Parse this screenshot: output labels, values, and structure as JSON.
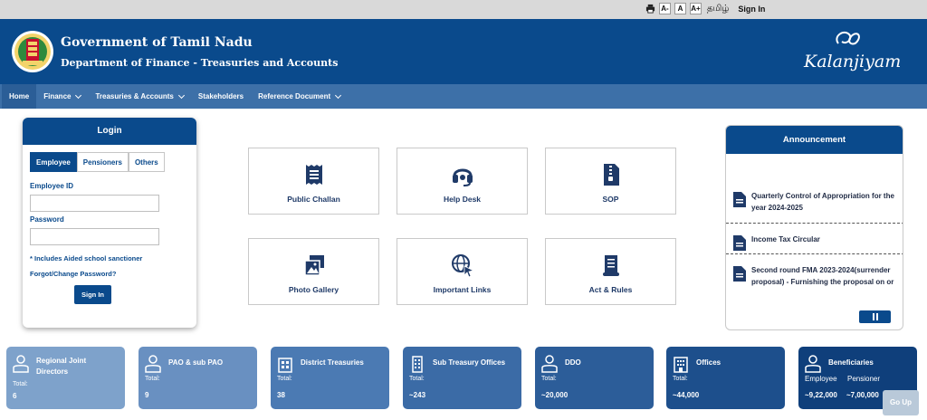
{
  "topbar": {
    "font_small": "A-",
    "font_normal": "A",
    "font_large": "A+",
    "language": "தமிழ்",
    "signin": "Sign In"
  },
  "header": {
    "title": "Government of Tamil Nadu",
    "subtitle": "Department of Finance - Treasuries and Accounts",
    "brand": "Kalanjiyam"
  },
  "nav": {
    "items": [
      {
        "label": "Home"
      },
      {
        "label": "Finance"
      },
      {
        "label": "Treasuries & Accounts"
      },
      {
        "label": "Stakeholders"
      },
      {
        "label": "Reference Document"
      }
    ]
  },
  "login": {
    "heading": "Login",
    "tabs": [
      "Employee",
      "Pensioners",
      "Others"
    ],
    "employee_id_label": "Employee ID",
    "employee_id_value": "",
    "password_label": "Password",
    "password_value": "",
    "note": "* Includes Aided school sanctioner",
    "forgot": "Forgot/Change Password?",
    "submit": "Sign In"
  },
  "services": [
    {
      "label": "Public Challan",
      "icon": "receipt-icon"
    },
    {
      "label": "Help Desk",
      "icon": "headset-icon"
    },
    {
      "label": "SOP",
      "icon": "zip-file-icon"
    },
    {
      "label": "Photo Gallery",
      "icon": "photo-gallery-icon"
    },
    {
      "label": "Important Links",
      "icon": "globe-cursor-icon"
    },
    {
      "label": "Act & Rules",
      "icon": "scroll-icon"
    }
  ],
  "announcement": {
    "heading": "Announcement",
    "items": [
      "Quarterly Control of Appropriation for the year 2024-2025",
      "Income Tax Circular",
      "Second round FMA 2023-2024(surrender proposal) - Furnishing the proposal on or"
    ]
  },
  "stats": [
    {
      "title": "Regional Joint Directors",
      "total_label": "Total:",
      "value": "6",
      "color": "#7ea2cb"
    },
    {
      "title": "PAO & sub PAO",
      "total_label": "Total:",
      "value": "9",
      "color": "#6990c1"
    },
    {
      "title": "District Treasuries",
      "total_label": "Total:",
      "value": "38",
      "color": "#4b7ab3"
    },
    {
      "title": "Sub Treasury Offices",
      "total_label": "Total:",
      "value": "~243",
      "color": "#3b6ba6"
    },
    {
      "title": "DDO",
      "total_label": "Total:",
      "value": "~20,000",
      "color": "#2c5d99"
    },
    {
      "title": "Offices",
      "total_label": "Total:",
      "value": "~44,000",
      "color": "#1d4f8c"
    },
    {
      "title": "Beneficiaries",
      "sub1": "Employee",
      "sub2": "Pensioner",
      "val1": "~9,22,000",
      "val2": "~7,00,000",
      "color": "#0f3f7b"
    }
  ],
  "go_up": "Go Up",
  "colors": {
    "primary": "#0a4a8c",
    "nav": "#3d70a8",
    "topbar": "#d9d9d9"
  }
}
